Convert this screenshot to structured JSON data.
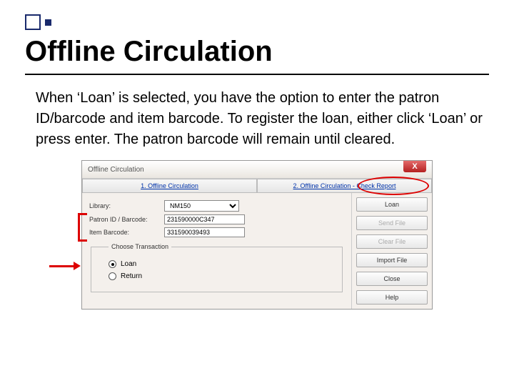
{
  "slide": {
    "title": "Offline Circulation",
    "body": "When ‘Loan’ is selected, you have the option to enter the patron ID/barcode and item barcode.  To register the loan, either click ‘Loan’ or press enter.  The patron barcode will remain until cleared."
  },
  "app": {
    "window_title": "Offline Circulation",
    "close_glyph": "X",
    "tabs": {
      "t1": "1. Offline Circulation",
      "t2": "2. Offline Circulation - Check Report"
    },
    "fields": {
      "library_label": "Library:",
      "library_value": "NM150",
      "patron_label": "Patron  ID / Barcode:",
      "patron_value": "231590000C347",
      "item_label": "Item Barcode:",
      "item_value": "331590039493"
    },
    "transaction": {
      "legend": "Choose Transaction",
      "loan": "Loan",
      "return": "Return"
    },
    "buttons": {
      "loan": "Loan",
      "send": "Send File",
      "clear": "Clear File",
      "import": "Import File",
      "close": "Close",
      "help": "Help"
    }
  }
}
